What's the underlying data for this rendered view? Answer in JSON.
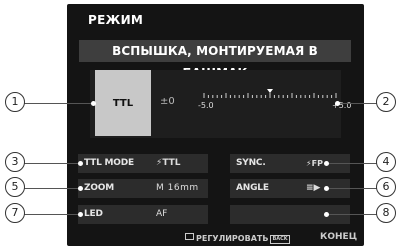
{
  "screen": {
    "title": "РЕЖИМ",
    "mode": "ВСПЫШКА, МОНТИРУЕМАЯ В БАШМАК",
    "main": {
      "ttl": "TTL",
      "compensation": "±0",
      "scale_min": "-5.0",
      "scale_max": "+5.0"
    },
    "rows": [
      {
        "left_label": "TTL MODE",
        "left_value": "⚡TTL",
        "right_label": "SYNC.",
        "right_value": "⚡FP"
      },
      {
        "left_label": "ZOOM",
        "left_value": "M 16mm",
        "right_label": "ANGLE",
        "right_value": "≡▶"
      },
      {
        "left_label": "LED",
        "left_value": "AF",
        "right_label": "",
        "right_value": ""
      }
    ],
    "footer": {
      "adjust_label": "РЕГУЛИРОВАТЬ",
      "back_key": "BACK",
      "end_label": "КОНЕЦ"
    }
  },
  "callouts": [
    "1",
    "2",
    "3",
    "4",
    "5",
    "6",
    "7",
    "8"
  ],
  "colors": {
    "screen_bg": "#141414",
    "panel_bg": "#2c2c2c",
    "highlight": "#c8c8c8"
  }
}
